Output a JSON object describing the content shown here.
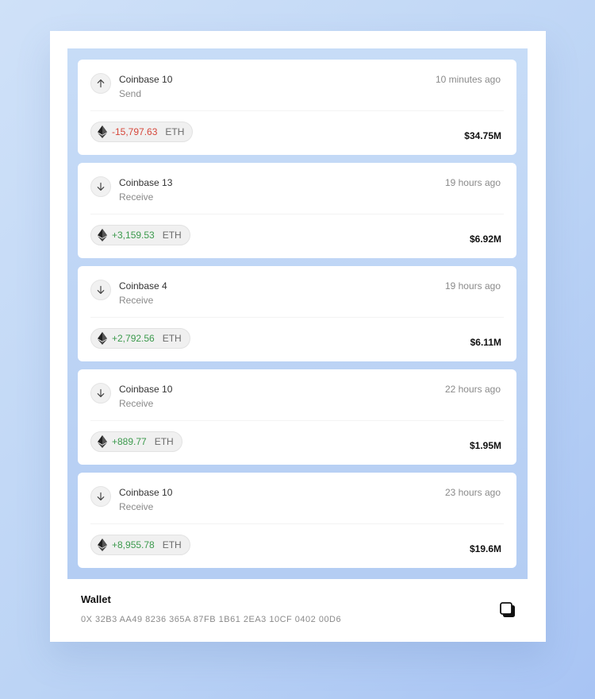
{
  "transactions": [
    {
      "direction": "up",
      "name": "Coinbase 10",
      "type": "Send",
      "time": "10 minutes ago",
      "amount": "-15,797.63",
      "sign": "neg",
      "unit": "ETH",
      "usd": "$34.75M"
    },
    {
      "direction": "down",
      "name": "Coinbase 13",
      "type": "Receive",
      "time": "19 hours ago",
      "amount": "+3,159.53",
      "sign": "pos",
      "unit": "ETH",
      "usd": "$6.92M"
    },
    {
      "direction": "down",
      "name": "Coinbase 4",
      "type": "Receive",
      "time": "19 hours ago",
      "amount": "+2,792.56",
      "sign": "pos",
      "unit": "ETH",
      "usd": "$6.11M"
    },
    {
      "direction": "down",
      "name": "Coinbase 10",
      "type": "Receive",
      "time": "22 hours ago",
      "amount": "+889.77",
      "sign": "pos",
      "unit": "ETH",
      "usd": "$1.95M"
    },
    {
      "direction": "down",
      "name": "Coinbase 10",
      "type": "Receive",
      "time": "23 hours ago",
      "amount": "+8,955.78",
      "sign": "pos",
      "unit": "ETH",
      "usd": "$19.6M"
    }
  ],
  "wallet": {
    "title": "Wallet",
    "address": "0X 32B3 AA49 8236 365A 87FB 1B61 2EA3 10CF 0402 00D6",
    "copy_icon": "copy-icon"
  },
  "colors": {
    "negative": "#d6473b",
    "positive": "#3c9a4d",
    "feed_background": "#c7dcf7"
  }
}
